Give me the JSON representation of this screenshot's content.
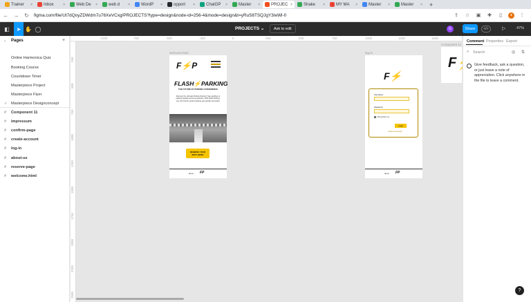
{
  "browser": {
    "tabs": [
      {
        "label": "Trainer",
        "color": "#f2a51a"
      },
      {
        "label": "Inbox",
        "color": "#ea4335"
      },
      {
        "label": "Web De",
        "color": "#34a853"
      },
      {
        "label": "web d",
        "color": "#34a853"
      },
      {
        "label": "WordP",
        "color": "#4285f4"
      },
      {
        "label": "opport",
        "color": "#24292f"
      },
      {
        "label": "ChatGP",
        "color": "#10a37f"
      },
      {
        "label": "Master",
        "color": "#34a853"
      },
      {
        "label": "PROJEC",
        "color": "#f24e1e",
        "active": true
      },
      {
        "label": "Shake",
        "color": "#34a853"
      },
      {
        "label": "MY MA",
        "color": "#ea4335"
      },
      {
        "label": "Master",
        "color": "#4285f4"
      },
      {
        "label": "Master",
        "color": "#34a853"
      }
    ],
    "new_tab": "+",
    "url": "figma.com/file/Ut7dQoyZDWdm7u76XeVCxg/PROJECTS?type=design&node-id=256-4&mode=design&t=yRuS8TSQJgY3IeWl-0"
  },
  "toolbar": {
    "file_title": "PROJECTS",
    "ask_to_edit": "Ask to edit",
    "avatar_letter": "G",
    "share_label": "Share",
    "zoom": "47%",
    "play": "▷"
  },
  "sidebar": {
    "pages_heading": "Pages",
    "pages": [
      "Online Harmonica Quiz",
      "Booking Course",
      "Countdown Timer",
      "Masterpiece Project",
      "Masterpiece Flyer",
      "Masterpiece Designconcept"
    ],
    "current_page": "Masterpiece Designconcept",
    "layers": [
      "Component 11",
      "impressum",
      "confirm-page",
      "create-account",
      "log-in",
      "about-us",
      "reserve-page",
      "welcome.html"
    ]
  },
  "ruler": {
    "top_ticks": [
      "-1000",
      "-750",
      "-500",
      "-250",
      "0",
      "250",
      "500",
      "750",
      "1000",
      "1250",
      "1500"
    ],
    "left_ticks": [
      "250",
      "500",
      "750",
      "1000",
      "1250",
      "1500",
      "1750",
      "2000",
      "2250",
      "2500"
    ]
  },
  "canvas": {
    "welcome_frame": {
      "label": "welcome.html",
      "logo": "F",
      "brand_left": "FLASH",
      "brand_right": "PARKING",
      "tagline": "THE FUTURE OF PARKING CONVENIENCE",
      "intro": "Discover the ultimate Parking Solution! Say goodbye to parking hassles and long searches. With Flash Parking, you can find the perfect parking spot quickly and easily.",
      "cta": "RESERVE YOUR SPOT HERE!",
      "footer_brand": "FP",
      "footer_small": "about"
    },
    "login_frame": {
      "label": "log-in",
      "logo": "F",
      "username_label": "Username:",
      "password_label": "Password:",
      "remember_label": "Remember me",
      "login_button": "Login",
      "create_link": "create an account",
      "footer_brand": "FP",
      "footer_small": "about"
    },
    "component_label": "Component 11"
  },
  "right_panel": {
    "tabs": [
      "Comment",
      "Properties",
      "Export"
    ],
    "search_placeholder": "Search",
    "feedback": "Give feedback, ask a question, or just leave a note of appreciation. Click anywhere in the file to leave a comment."
  },
  "colors": {
    "accent": "#0d99ff",
    "brand_yellow": "#f5c400",
    "toolbar_bg": "#2c2c2c"
  }
}
